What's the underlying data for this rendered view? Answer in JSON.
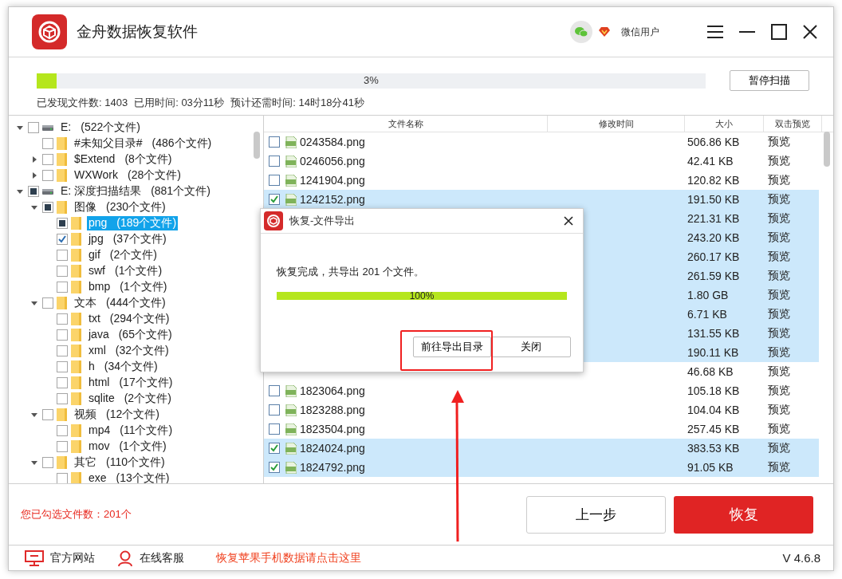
{
  "app": {
    "title": "金舟数据恢复软件",
    "user_name": "微信用户"
  },
  "scan": {
    "level": 0.03,
    "percent": "3%",
    "pause_button": "暂停扫描",
    "stats": [
      "已发现文件数: 1403",
      "已用时间: 03分11秒",
      "预计还需时间: 14时18分41秒"
    ]
  },
  "tree": [
    {
      "kind": "drive",
      "label": "E:",
      "count": "(522个文件)",
      "expanded": true,
      "checked": false,
      "partial": false,
      "selected": false,
      "children": [
        {
          "kind": "folder",
          "label": "#未知父目录#",
          "count": "(486个文件)",
          "checked": false,
          "partial": false,
          "selected": false
        },
        {
          "kind": "folder",
          "label": "$Extend",
          "count": "(8个文件)",
          "expanded": false,
          "checked": false,
          "partial": false,
          "selected": false
        },
        {
          "kind": "folder",
          "label": "WXWork",
          "count": "(28个文件)",
          "expanded": false,
          "checked": false,
          "partial": false,
          "selected": false
        }
      ]
    },
    {
      "kind": "drive",
      "label": "E: 深度扫描结果",
      "count": "(881个文件)",
      "expanded": true,
      "checked": false,
      "partial": true,
      "selected": false,
      "children": [
        {
          "kind": "folder",
          "label": "图像",
          "count": "(230个文件)",
          "expanded": true,
          "checked": false,
          "partial": true,
          "selected": false,
          "children": [
            {
              "kind": "folder",
              "label": "png",
              "count": "(189个文件)",
              "checked": false,
              "partial": true,
              "selected": true
            },
            {
              "kind": "folder",
              "label": "jpg",
              "count": "(37个文件)",
              "checked": true,
              "selected": false
            },
            {
              "kind": "folder",
              "label": "gif",
              "count": "(2个文件)",
              "checked": false,
              "partial": false,
              "selected": false
            },
            {
              "kind": "folder",
              "label": "swf",
              "count": "(1个文件)",
              "checked": false,
              "partial": false,
              "selected": false
            },
            {
              "kind": "folder",
              "label": "bmp",
              "count": "(1个文件)",
              "checked": false,
              "partial": false,
              "selected": false
            }
          ]
        },
        {
          "kind": "folder",
          "label": "文本",
          "count": "(444个文件)",
          "expanded": true,
          "checked": false,
          "partial": false,
          "selected": false,
          "children": [
            {
              "kind": "folder",
              "label": "txt",
              "count": "(294个文件)",
              "checked": false,
              "partial": false,
              "selected": false
            },
            {
              "kind": "folder",
              "label": "java",
              "count": "(65个文件)",
              "checked": false,
              "partial": false,
              "selected": false
            },
            {
              "kind": "folder",
              "label": "xml",
              "count": "(32个文件)",
              "checked": false,
              "partial": false,
              "selected": false
            },
            {
              "kind": "folder",
              "label": "h",
              "count": "(34个文件)",
              "checked": false,
              "partial": false,
              "selected": false
            },
            {
              "kind": "folder",
              "label": "html",
              "count": "(17个文件)",
              "checked": false,
              "partial": false,
              "selected": false
            },
            {
              "kind": "folder",
              "label": "sqlite",
              "count": "(2个文件)",
              "checked": false,
              "partial": false,
              "selected": false
            }
          ]
        },
        {
          "kind": "folder",
          "label": "视频",
          "count": "(12个文件)",
          "expanded": true,
          "checked": false,
          "partial": false,
          "selected": false,
          "children": [
            {
              "kind": "folder",
              "label": "mp4",
              "count": "(11个文件)",
              "checked": false,
              "partial": false,
              "selected": false
            },
            {
              "kind": "folder",
              "label": "mov",
              "count": "(1个文件)",
              "checked": false,
              "partial": false,
              "selected": false
            }
          ]
        },
        {
          "kind": "folder",
          "label": "其它",
          "count": "(110个文件)",
          "expanded": true,
          "checked": false,
          "partial": false,
          "selected": false,
          "children": [
            {
              "kind": "folder",
              "label": "exe",
              "count": "(13个文件)",
              "checked": false,
              "partial": false,
              "selected": false
            }
          ]
        }
      ]
    }
  ],
  "table": {
    "columns": [
      "文件名称",
      "修改时间",
      "大小",
      "双击预览"
    ],
    "rows": [
      {
        "name": "0243584.png",
        "size": "506.86 KB",
        "preview": "预览",
        "checked": false
      },
      {
        "name": "0246056.png",
        "size": "42.41 KB",
        "preview": "预览",
        "checked": false
      },
      {
        "name": "1241904.png",
        "size": "120.82 KB",
        "preview": "预览",
        "checked": false
      },
      {
        "name": "1242152.png",
        "size": "191.50 KB",
        "preview": "预览",
        "checked": true
      },
      {
        "size": "221.31 KB",
        "preview": "预览",
        "checked": true
      },
      {
        "size": "243.20 KB",
        "preview": "预览",
        "checked": true
      },
      {
        "size": "260.17 KB",
        "preview": "预览",
        "checked": true
      },
      {
        "size": "261.59 KB",
        "preview": "预览",
        "checked": true
      },
      {
        "size": "1.80 GB",
        "preview": "预览",
        "checked": true
      },
      {
        "size": "6.71 KB",
        "preview": "预览",
        "checked": true
      },
      {
        "size": "131.55 KB",
        "preview": "预览",
        "checked": true
      },
      {
        "size": "190.11 KB",
        "preview": "预览",
        "checked": true
      },
      {
        "size": "46.68 KB",
        "preview": "预览",
        "checked": false
      },
      {
        "name": "1823064.png",
        "size": "105.18 KB",
        "preview": "预览",
        "checked": false
      },
      {
        "name": "1823288.png",
        "size": "104.04 KB",
        "preview": "预览",
        "checked": false
      },
      {
        "name": "1823504.png",
        "size": "257.45 KB",
        "preview": "预览",
        "checked": false
      },
      {
        "name": "1824024.png",
        "size": "383.53 KB",
        "preview": "预览",
        "checked": true
      },
      {
        "name": "1824792.png",
        "size": "91.05 KB",
        "preview": "预览",
        "checked": true
      }
    ]
  },
  "dialog": {
    "title": "恢复-文件导出",
    "message": "恢复完成，共导出 201 个文件。",
    "level": 1,
    "percent": "100%",
    "buttons": [
      "前往导出目录",
      "关闭"
    ]
  },
  "bottom": {
    "selected_count": "您已勾选文件数：201个",
    "back_button": "上一步",
    "recover_button": "恢复"
  },
  "footer": {
    "links": [
      {
        "kind": "website",
        "label": "官方网站"
      },
      {
        "kind": "support",
        "label": "在线客服"
      }
    ],
    "promo_link": "恢复苹果手机数据请点击这里",
    "version": "V 4.6.8"
  }
}
